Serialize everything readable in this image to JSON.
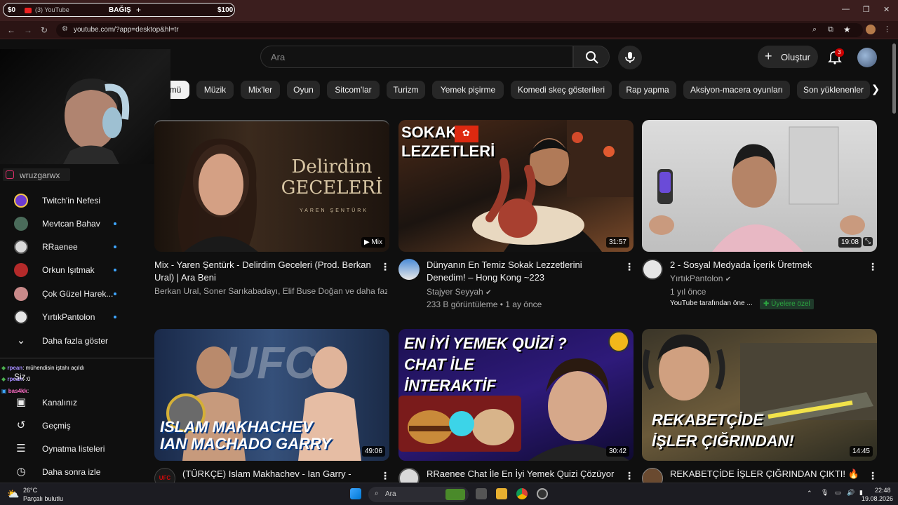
{
  "browser": {
    "tab_left_amount": "$0",
    "tab_title": "(3) YouTube",
    "tab_donate": "BAĞIŞ",
    "tab_plus": "+",
    "tab_right_amount": "$100",
    "url": "youtube.com/?app=desktop&hl=tr"
  },
  "header": {
    "search_placeholder": "Ara",
    "create_label": "Oluştur",
    "notification_count": "3"
  },
  "chips": [
    {
      "label": "mü",
      "active": true
    },
    {
      "label": "Müzik"
    },
    {
      "label": "Mix'ler"
    },
    {
      "label": "Oyun"
    },
    {
      "label": "Sitcom'lar"
    },
    {
      "label": "Turizm"
    },
    {
      "label": "Yemek pişirme"
    },
    {
      "label": "Komedi skeç gösterileri"
    },
    {
      "label": "Rap yapma"
    },
    {
      "label": "Aksiyon-macera oyunları"
    },
    {
      "label": "Son yüklenenler"
    }
  ],
  "overlay": {
    "instagram_handle": "wruzgarwx"
  },
  "sidebar": {
    "subscriptions": [
      {
        "name": "Twitch'in Nefesi",
        "live": false,
        "color": "#6d3bd1"
      },
      {
        "name": "Mevtcan Bahav",
        "live": true,
        "color": "#4a6b5a"
      },
      {
        "name": "RRaenee",
        "live": true,
        "color": "#d9d9d9"
      },
      {
        "name": "Orkun Işıtmak",
        "live": true,
        "color": "#b42a2a"
      },
      {
        "name": "Çok Güzel Harek...",
        "live": true,
        "color": "#c98a8a"
      },
      {
        "name": "YırtıkPantolon",
        "live": true,
        "color": "#e6e6e6"
      }
    ],
    "show_more": "Daha fazla göster",
    "you_section": "Siz",
    "items": [
      {
        "label": "Kanalınız",
        "icon": "channel-icon"
      },
      {
        "label": "Geçmiş",
        "icon": "history-icon"
      },
      {
        "label": "Oynatma listeleri",
        "icon": "playlists-icon"
      },
      {
        "label": "Daha sonra izle",
        "icon": "watch-later-icon"
      }
    ]
  },
  "chat": [
    {
      "user": "rpean",
      "text": ": mühendisin iştahı açıldı",
      "color": "#a48cff"
    },
    {
      "user": "rpean",
      "text": ": :0",
      "color": "#a48cff"
    },
    {
      "user": "bas4kk",
      "text": ":",
      "color": "#ff6ec7"
    }
  ],
  "videos": [
    {
      "title": "Mix - Yaren Şentürk - Delirdim Geceleri (Prod. Berkan Ural) | Ara Beni",
      "channel": "Berkan Ural, Soner Sarıkabadayı, Elif Buse Doğan ve daha fazla...",
      "meta": "",
      "badge": "Mix",
      "thumb_text": "Delirdim\nGECELERİ",
      "thumb_sub": "YAREN ŞENTÜRK"
    },
    {
      "title": "Dünyanın En Temiz Sokak Lezzetlerini Denedim! – Hong Kong ~223",
      "channel": "Stajyer Seyyah",
      "meta": "233 B görüntüleme • 1 ay önce",
      "duration": "31:57",
      "thumb_text": "SOKAK\nLEZZETLERİ"
    },
    {
      "title": "2 - Sosyal Medyada İçerik Üretmek",
      "channel": "YırtıkPantolon",
      "meta": "1 yıl önce",
      "extra": "YouTube tarafından öne ...",
      "members_badge": "Üyelere özel",
      "duration": "19:08"
    },
    {
      "title": "(TÜRKÇE) Islam Makhachev - Ian Garry -",
      "duration": "49:06",
      "thumb_text": "ISLAM MAKHACHEV\nIAN MACHADO GARRY",
      "thumb_logo": "UFC"
    },
    {
      "title": "RRaenee Chat İle En İyi Yemek Quizi Çözüyor",
      "duration": "30:42",
      "thumb_text": "EN İYİ YEMEK QUİZİ ?\nCHAT İLE\nİNTERAKTİF"
    },
    {
      "title": "REKABETÇİDE İŞLER ÇIĞRINDAN ÇIKTI! 🔥",
      "duration": "14:45",
      "thumb_text": "REKABETÇİDE\nİŞLER ÇIĞRINDAN!"
    }
  ],
  "taskbar": {
    "weather_temp": "26°C",
    "weather_desc": "Parçalı bulutlu",
    "search_label": "Ara",
    "time": "22:48",
    "date": "19.08.2026"
  }
}
